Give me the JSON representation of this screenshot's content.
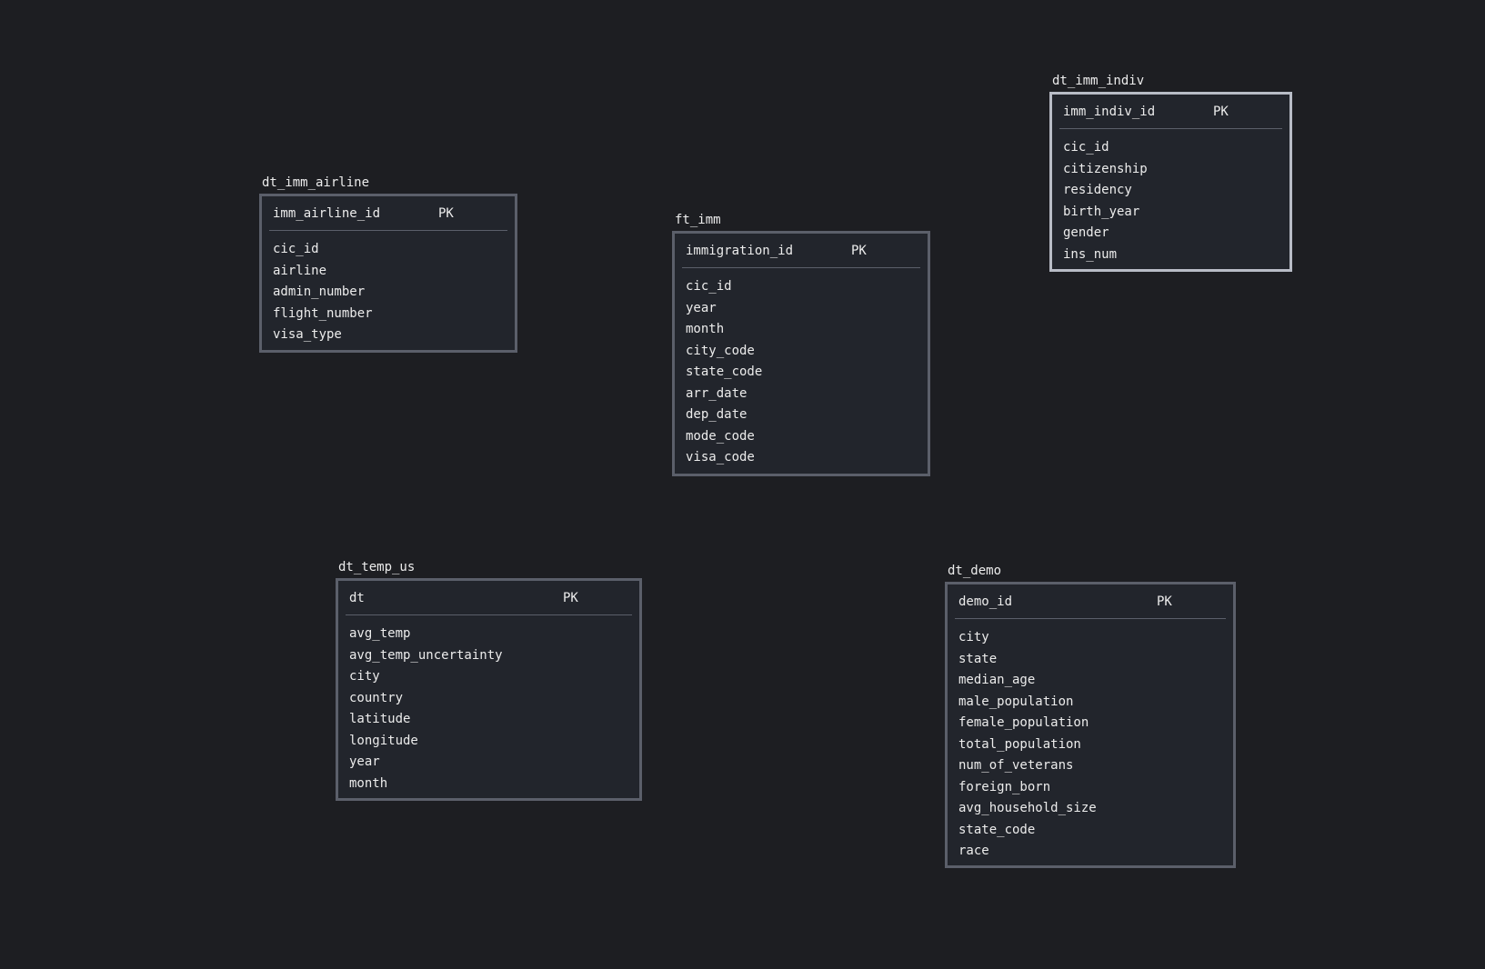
{
  "tables": [
    {
      "key": "dt_imm_airline",
      "name": "dt_imm_airline",
      "pk_field": "imm_airline_id",
      "pk_label": "PK",
      "fields": [
        "cic_id",
        "airline",
        "admin_number",
        "flight_number",
        "visa_type"
      ]
    },
    {
      "key": "ft_imm",
      "name": "ft_imm",
      "pk_field": "immigration_id",
      "pk_label": "PK",
      "fields": [
        "cic_id",
        "year",
        "month",
        "city_code",
        "state_code",
        "arr_date",
        "dep_date",
        "mode_code",
        "visa_code"
      ]
    },
    {
      "key": "dt_imm_indiv",
      "name": "dt_imm_indiv",
      "pk_field": "imm_indiv_id",
      "pk_label": "PK",
      "fields": [
        "cic_id",
        "citizenship",
        "residency",
        "birth_year",
        "gender",
        "ins_num"
      ]
    },
    {
      "key": "dt_temp_us",
      "name": "dt_temp_us",
      "pk_field": "dt",
      "pk_label": "PK",
      "fields": [
        "avg_temp",
        "avg_temp_uncertainty",
        "city",
        "country",
        "latitude",
        "longitude",
        "year",
        "month"
      ]
    },
    {
      "key": "dt_demo",
      "name": "dt_demo",
      "pk_field": "demo_id",
      "pk_label": "PK",
      "fields": [
        "city",
        "state",
        "median_age",
        "male_population",
        "female_population",
        "total_population",
        "num_of_veterans",
        "foreign_born",
        "avg_household_size",
        "state_code",
        "race"
      ]
    }
  ],
  "colors": {
    "background": "#1d1e22",
    "table_fill": "#22252c",
    "table_border": "#5b5f6a",
    "selected_border": "#b8bcc6",
    "text": "#ececec"
  }
}
